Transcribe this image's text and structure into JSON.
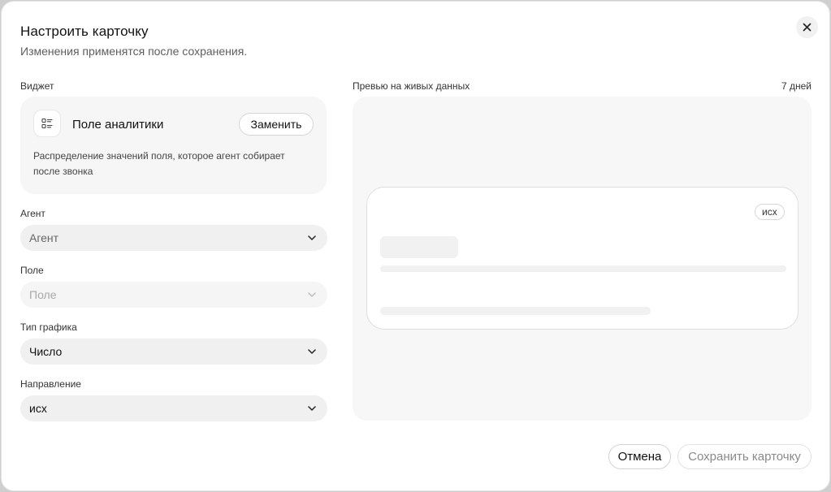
{
  "dialog": {
    "title": "Настроить карточку",
    "subtitle": "Изменения применятся после сохранения."
  },
  "widget": {
    "section_label": "Виджет",
    "name": "Поле аналитики",
    "replace_label": "Заменить",
    "description": "Распределение значений поля, которое агент собирает после звонка",
    "icon": "list-icon"
  },
  "fields": {
    "agent": {
      "label": "Агент",
      "placeholder": "Агент"
    },
    "field": {
      "label": "Поле",
      "placeholder": "Поле"
    },
    "chart_type": {
      "label": "Тип графика",
      "value": "Число"
    },
    "direction": {
      "label": "Направление",
      "value": "исх"
    }
  },
  "preview": {
    "label": "Превью на живых данных",
    "period": "7 дней",
    "direction_badge": "исх"
  },
  "footer": {
    "cancel_label": "Отмена",
    "save_label": "Сохранить карточку"
  }
}
